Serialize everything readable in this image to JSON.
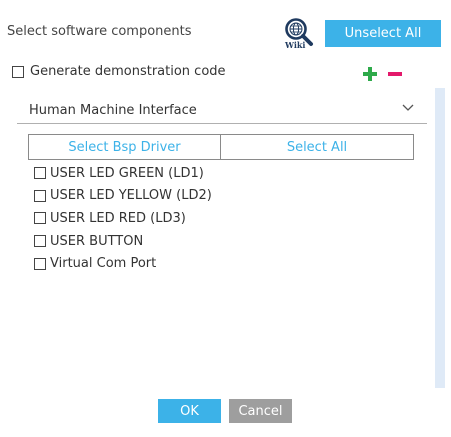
{
  "header": {
    "title": "Select software components",
    "wiki_label": "Wiki",
    "unselect_all_label": "Unselect All"
  },
  "generate_demo": {
    "label": "Generate demonstration code",
    "checked": false
  },
  "toolbar": {
    "add_icon": "plus-icon",
    "remove_icon": "minus-icon",
    "add_color": "#2eaa4a",
    "remove_color": "#e3196b"
  },
  "panel": {
    "title": "Human Machine Interface",
    "select_bsp_label": "Select Bsp Driver",
    "select_all_label": "Select All",
    "components": [
      {
        "label": "USER LED GREEN (LD1)",
        "checked": false
      },
      {
        "label": "USER LED YELLOW (LD2)",
        "checked": false
      },
      {
        "label": "USER LED RED (LD3)",
        "checked": false
      },
      {
        "label": "USER BUTTON",
        "checked": false
      },
      {
        "label": "Virtual Com Port",
        "checked": false
      }
    ]
  },
  "footer": {
    "ok_label": "OK",
    "cancel_label": "Cancel"
  },
  "colors": {
    "accent": "#3cb2e8",
    "cancel": "#9e9e9e",
    "scrollbar": "#dfeaf7"
  }
}
